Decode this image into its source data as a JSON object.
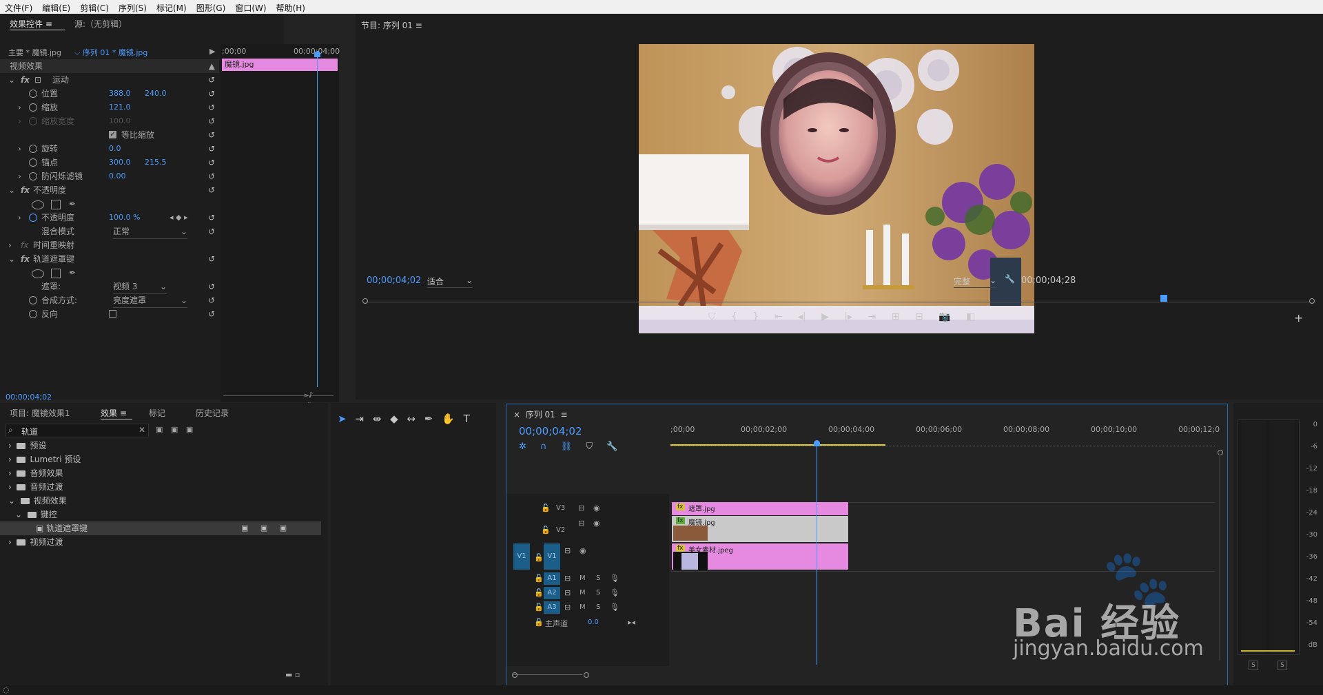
{
  "menu": [
    "文件(F)",
    "编辑(E)",
    "剪辑(C)",
    "序列(S)",
    "标记(M)",
    "图形(G)",
    "窗口(W)",
    "帮助(H)"
  ],
  "effect_controls": {
    "tab_active": "效果控件",
    "tab_menu": "≡",
    "tab_source": "源:（无剪辑）",
    "master_label": "主要 * 魔镜.jpg",
    "sequence_label": "序列 01 * 魔镜.jpg",
    "timecode_start": ";00;00",
    "timecode_end": "00;00;04;00",
    "clip_label": "魔镜.jpg",
    "section_video": "视频效果",
    "motion": "运动",
    "position_label": "位置",
    "position_x": "388.0",
    "position_y": "240.0",
    "scale_label": "缩放",
    "scale_value": "121.0",
    "scale_width_label": "缩放宽度",
    "scale_width_value": "100.0",
    "uniform_scale": "等比缩放",
    "rotation_label": "旋转",
    "rotation_value": "0.0",
    "anchor_label": "锚点",
    "anchor_x": "300.0",
    "anchor_y": "215.5",
    "flicker_label": "防闪烁滤镜",
    "flicker_value": "0.00",
    "opacity_section": "不透明度",
    "opacity_label": "不透明度",
    "opacity_value": "100.0 %",
    "blend_label": "混合模式",
    "blend_value": "正常",
    "time_remap": "时间重映射",
    "track_matte": "轨道遮罩键",
    "matte_label": "遮罩:",
    "matte_value": "视频 3",
    "composite_label": "合成方式:",
    "composite_value": "亮度遮罩",
    "reverse_label": "反向",
    "bottom_timecode": "00;00;04;02"
  },
  "program": {
    "title": "节目: 序列 01",
    "menu": "≡",
    "timecode": "00;00;04;02",
    "fit": "适合",
    "quality": "完整",
    "duration": "00;00;04;28"
  },
  "project": {
    "tab_project": "项目: 魔镜效果1",
    "tab_effects": "效果",
    "tab_menu": "≡",
    "tab_markers": "标记",
    "tab_history": "历史记录",
    "search_value": "轨道",
    "tree": [
      {
        "label": "预设",
        "level": 0
      },
      {
        "label": "Lumetri 预设",
        "level": 0
      },
      {
        "label": "音频效果",
        "level": 0
      },
      {
        "label": "音频过渡",
        "level": 0
      },
      {
        "label": "视频效果",
        "level": 0
      },
      {
        "label": "键控",
        "level": 1
      },
      {
        "label": "轨道遮罩键",
        "level": 2
      },
      {
        "label": "视频过渡",
        "level": 0
      }
    ]
  },
  "timeline": {
    "title": "序列 01",
    "menu": "≡",
    "timecode": "00;00;04;02",
    "ruler": [
      ";00;00",
      "00;00;02;00",
      "00;00;04;00",
      "00;00;06;00",
      "00;00;08;00",
      "00;00;10;00",
      "00;00;12;0"
    ],
    "tracks": {
      "v3": "V3",
      "v2": "V2",
      "v1": "V1",
      "v1_src": "V1",
      "a1": "A1",
      "a2": "A2",
      "a3": "A3",
      "m": "M",
      "s": "S",
      "master": "主声道",
      "master_value": "0.0"
    },
    "clips": {
      "v3": "遮罩.jpg",
      "v2": "魔镜.jpg",
      "v1": "美女素材.jpeg"
    }
  },
  "meter": {
    "labels": [
      "0",
      "-6",
      "-12",
      "-18",
      "-24",
      "-30",
      "-36",
      "-42",
      "-48",
      "-54",
      "dB"
    ],
    "s1": "S",
    "s2": "S"
  },
  "watermark": {
    "brand": "Bai 经验",
    "url": "jingyan.baidu.com"
  },
  "colors": {
    "accent": "#4b9cff",
    "clip_pink": "#e58ae0",
    "clip_gray": "#c9c9c9",
    "track_blue": "#1b5e8a"
  }
}
